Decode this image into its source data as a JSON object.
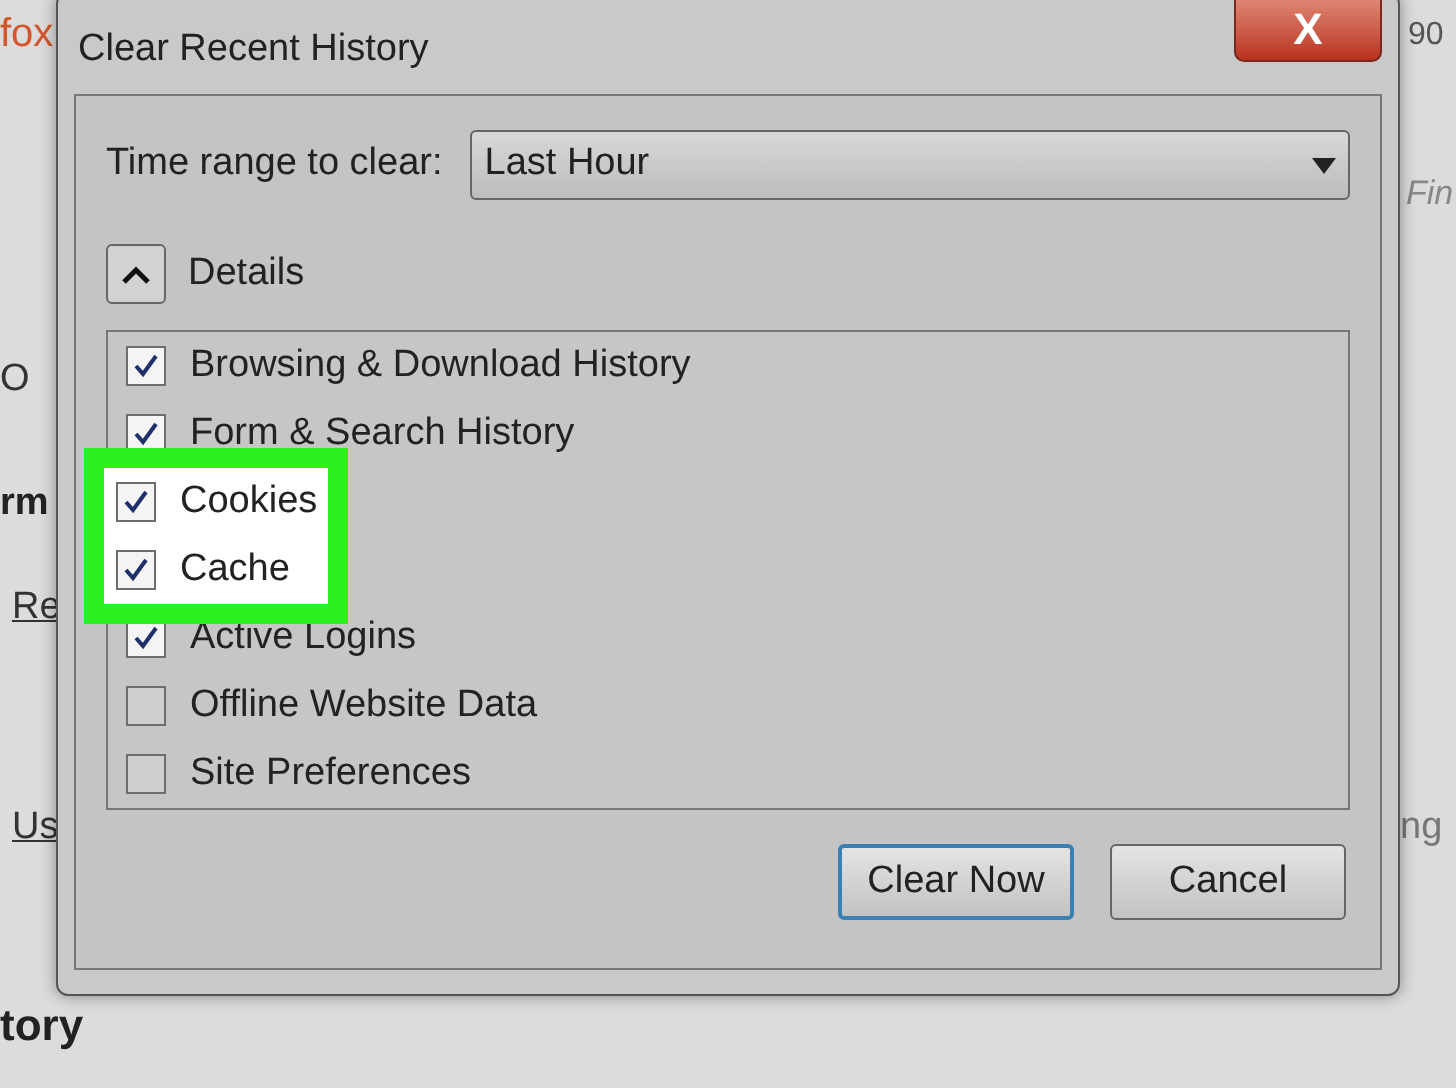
{
  "background_page": {
    "fragments": [
      {
        "kind": "brand",
        "text": "fox"
      },
      {
        "kind": "zoom",
        "text": "90"
      },
      {
        "kind": "find",
        "text": "Fin"
      },
      {
        "kind": "plain",
        "text": "O"
      },
      {
        "kind": "heading",
        "text": "rm"
      },
      {
        "kind": "link",
        "text": "Re"
      },
      {
        "kind": "link2",
        "text": "Us"
      },
      {
        "kind": "right",
        "text": "ng"
      },
      {
        "kind": "heading2",
        "text": "tory"
      }
    ]
  },
  "dialog": {
    "title": "Clear Recent History",
    "close_label": "X",
    "time_range": {
      "label": "Time range to clear:",
      "value": "Last Hour"
    },
    "details": {
      "label": "Details",
      "expanded": true
    },
    "items": [
      {
        "label": "Browsing & Download History",
        "checked": true,
        "highlighted": false
      },
      {
        "label": "Form & Search History",
        "checked": true,
        "highlighted": false
      },
      {
        "label": "Cookies",
        "checked": true,
        "highlighted": true
      },
      {
        "label": "Cache",
        "checked": true,
        "highlighted": true
      },
      {
        "label": "Active Logins",
        "checked": true,
        "highlighted": false
      },
      {
        "label": "Offline Website Data",
        "checked": false,
        "highlighted": false
      },
      {
        "label": "Site Preferences",
        "checked": false,
        "highlighted": false
      }
    ],
    "buttons": [
      {
        "label": "Clear Now",
        "selected": true
      },
      {
        "label": "Cancel",
        "selected": false
      }
    ]
  }
}
